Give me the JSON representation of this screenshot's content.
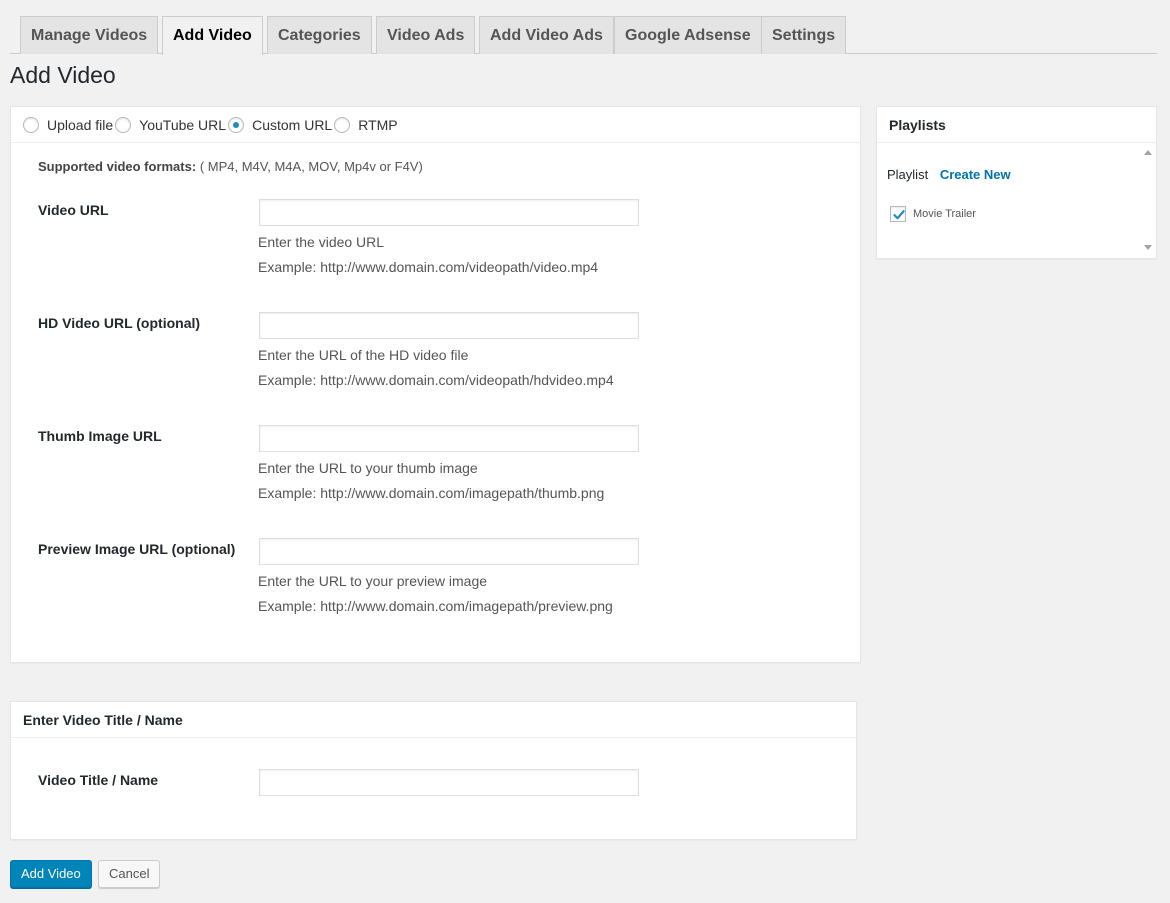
{
  "tabs": [
    {
      "label": "Manage Videos",
      "active": false
    },
    {
      "label": "Add Video",
      "active": true
    },
    {
      "label": "Categories",
      "active": false
    },
    {
      "label": "Video Ads",
      "active": false
    },
    {
      "label": "Add Video Ads",
      "active": false
    },
    {
      "label": "Google Adsense",
      "active": false
    },
    {
      "label": "Settings",
      "active": false
    }
  ],
  "page_title": "Add Video",
  "source_options": [
    {
      "label": "Upload file",
      "checked": false
    },
    {
      "label": "YouTube URL",
      "checked": false
    },
    {
      "label": "Custom URL",
      "checked": true
    },
    {
      "label": "RTMP",
      "checked": false
    }
  ],
  "formats": {
    "label": "Supported video formats:",
    "value": "( MP4, M4V, M4A, MOV, Mp4v or F4V)"
  },
  "fields": [
    {
      "label": "Video URL",
      "value": "",
      "help": "Enter the video URL",
      "example": "Example: http://www.domain.com/videopath/video.mp4"
    },
    {
      "label": "HD Video URL (optional)",
      "value": "",
      "help": "Enter the URL of the HD video file",
      "example": "Example: http://www.domain.com/videopath/hdvideo.mp4"
    },
    {
      "label": "Thumb Image URL",
      "value": "",
      "help": "Enter the URL to your thumb image",
      "example": "Example: http://www.domain.com/imagepath/thumb.png"
    },
    {
      "label": "Preview Image URL (optional)",
      "value": "",
      "help": "Enter the URL to your preview image",
      "example": "Example: http://www.domain.com/imagepath/preview.png"
    }
  ],
  "title_panel": {
    "heading": "Enter Video Title / Name",
    "field_label": "Video Title / Name",
    "value": ""
  },
  "playlists": {
    "heading": "Playlists",
    "label": "Playlist",
    "create_link": "Create New",
    "items": [
      {
        "label": "Movie Trailer",
        "checked": true
      }
    ]
  },
  "buttons": {
    "submit": "Add Video",
    "cancel": "Cancel"
  },
  "colors": {
    "accent": "#0085ba",
    "link": "#0073aa",
    "background": "#f1f1f1"
  }
}
